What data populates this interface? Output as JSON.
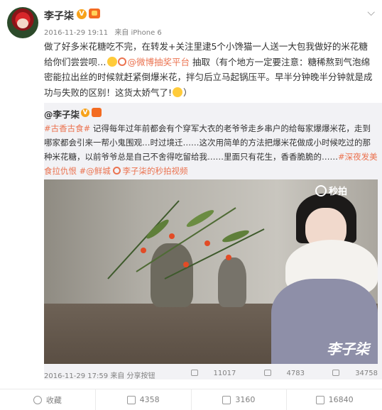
{
  "post": {
    "username": "李子柒",
    "verified_mark": "V",
    "meta": {
      "date": "2016-11-29 19:11",
      "source": "来自 iPhone 6"
    },
    "text_before_link": "做了好多米花糖吃不完，在转发+关注里逮5个小馋猫一人送一大包我做好的米花糖给你们尝尝呗…",
    "link_label": "@微博抽奖平台",
    "text_after_link": " 抽取（有个地方一定要注意：糖稀熬到气泡绵密能拉出丝的时候就赶紧倒爆米花，拌匀后立马起锅压平。早半分钟晚半分钟就是成功与失败的区别！这货太娇气了!",
    "text_end": "）"
  },
  "repost": {
    "username": "@李子柒",
    "verified_mark": "V",
    "tag_1": "#古香古食#",
    "text": " 记得每年过年前都会有个穿军大衣的老爷爷走乡串户的给每家爆爆米花，走到哪家都会引来一帮小鬼围观…时过境迁……这次用简单的方法把爆米花做成小时候吃过的那种米花糖，以前爷爷总是自己不舍得吃留给我……里面只有花生，香香脆脆的……",
    "tag_2": "#深夜发美食拉仇恨",
    "location": "#@鲜城",
    "video_link": "李子柒的秒拍视频",
    "video_watermark": "秒拍",
    "video_signature": "李子柒",
    "footer": {
      "date": "2016-11-29 17:59",
      "source": "来自 分享按钮",
      "reposts": "11017",
      "comments": "4783",
      "likes": "34758"
    }
  },
  "actions": {
    "favorite": "收藏",
    "repost": "4358",
    "comment": "3160",
    "like": "16840"
  }
}
